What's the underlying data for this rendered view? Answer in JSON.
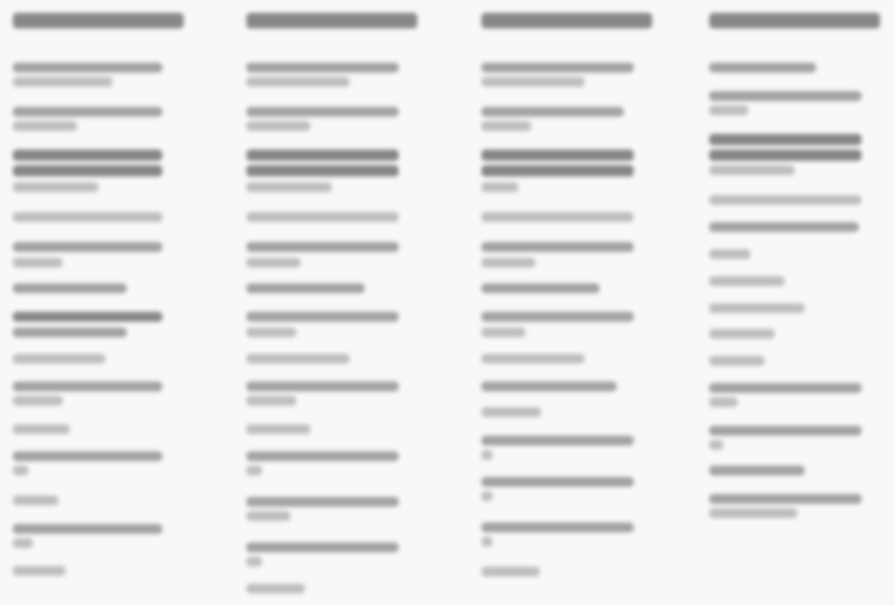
{
  "columns": [
    {
      "heading": "",
      "items": [
        {
          "text": ""
        },
        {
          "text": ""
        },
        {
          "text": ""
        },
        {
          "text": ""
        },
        {
          "text": ""
        },
        {
          "text": ""
        },
        {
          "text": ""
        },
        {
          "text": ""
        },
        {
          "text": ""
        },
        {
          "text": ""
        },
        {
          "text": ""
        },
        {
          "text": ""
        },
        {
          "text": ""
        },
        {
          "text": ""
        }
      ]
    },
    {
      "heading": "",
      "items": [
        {
          "text": ""
        },
        {
          "text": ""
        },
        {
          "text": ""
        },
        {
          "text": ""
        },
        {
          "text": ""
        },
        {
          "text": ""
        },
        {
          "text": ""
        },
        {
          "text": ""
        },
        {
          "text": ""
        },
        {
          "text": ""
        },
        {
          "text": ""
        },
        {
          "text": ""
        },
        {
          "text": ""
        },
        {
          "text": ""
        }
      ]
    },
    {
      "heading": "",
      "items": [
        {
          "text": ""
        },
        {
          "text": ""
        },
        {
          "text": ""
        },
        {
          "text": ""
        },
        {
          "text": ""
        },
        {
          "text": ""
        },
        {
          "text": ""
        },
        {
          "text": ""
        },
        {
          "text": ""
        },
        {
          "text": ""
        },
        {
          "text": ""
        },
        {
          "text": ""
        },
        {
          "text": ""
        }
      ]
    },
    {
      "heading": "",
      "items": [
        {
          "text": ""
        },
        {
          "text": ""
        },
        {
          "text": ""
        },
        {
          "text": ""
        },
        {
          "text": ""
        },
        {
          "text": ""
        },
        {
          "text": ""
        },
        {
          "text": ""
        },
        {
          "text": ""
        },
        {
          "text": ""
        },
        {
          "text": ""
        },
        {
          "text": ""
        }
      ]
    }
  ]
}
